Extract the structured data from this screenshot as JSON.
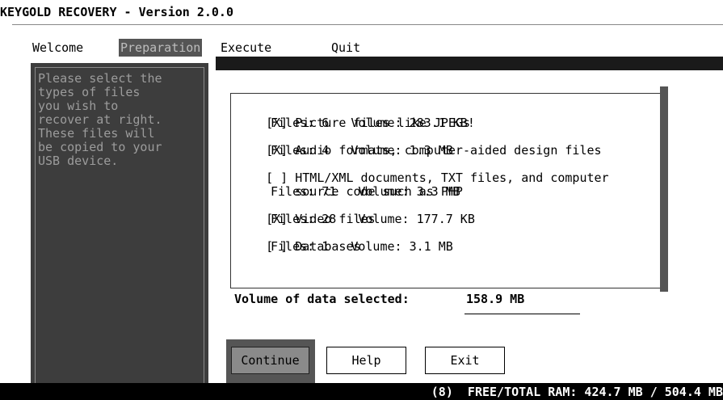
{
  "window": {
    "title": "KEYGOLD RECOVERY - Version 2.0.0"
  },
  "menu": {
    "items": [
      {
        "label": "Welcome",
        "active": false
      },
      {
        "label": "Preparation",
        "active": true
      },
      {
        "label": "Execute",
        "active": false
      },
      {
        "label": "Quit",
        "active": false
      }
    ]
  },
  "sidebar": {
    "text": "Please select the\ntypes of files\nyou wish to\nrecover at right.\nThese files will\nbe copied to your\nUSB device."
  },
  "file_types": [
    {
      "checkbox": "[X]",
      "checked": true,
      "description": "Picture files like JPEGs",
      "stats": "Files: 6   Volume: 283.1 KB!"
    },
    {
      "checkbox": "[X]",
      "checked": true,
      "description": "Audio formats, computer-aided design files",
      "stats": "Files: 4   Volume: 1.3 MB"
    },
    {
      "checkbox": "[ ]",
      "checked": false,
      "description": "HTML/XML documents, TXT files, and computer\nsource code such as PHP",
      "stats": "Files: 71   Volume: 3.3 MB"
    },
    {
      "checkbox": "[X]",
      "checked": true,
      "description": "Video files",
      "stats": "Files: 28   Volume: 177.7 KB"
    },
    {
      "checkbox": "[ ]",
      "checked": false,
      "description": "Databases",
      "stats": "Files: 1   Volume: 3.1 MB"
    }
  ],
  "selection": {
    "label": "Volume of data selected:",
    "value": "158.9 MB"
  },
  "buttons": {
    "continue": "Continue",
    "help": "Help",
    "exit": "Exit"
  },
  "status": {
    "text": "(8)  FREE/TOTAL RAM: 424.7 MB / 504.4 MB"
  }
}
